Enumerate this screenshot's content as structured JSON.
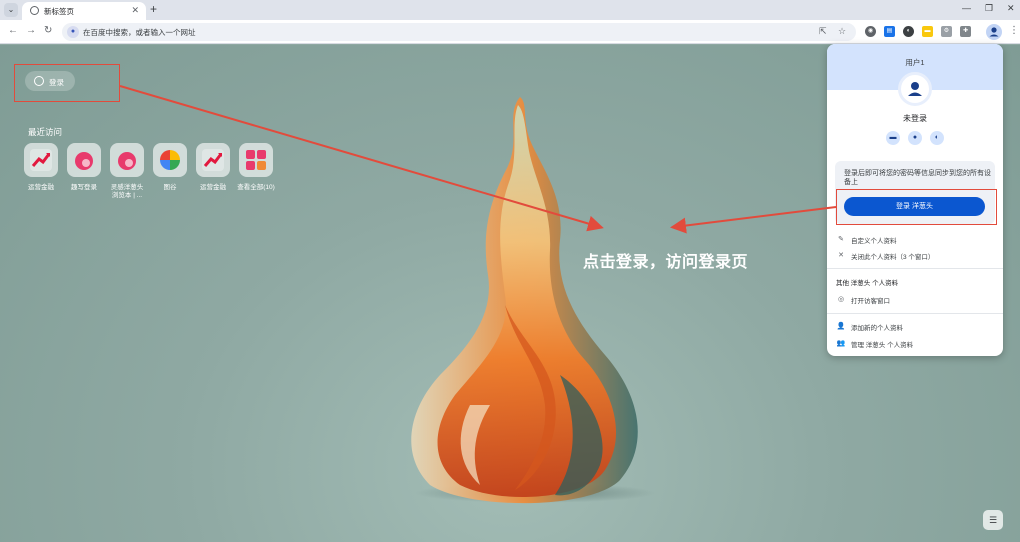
{
  "tab": {
    "title": "新标签页"
  },
  "omnibox": {
    "placeholder": "在百度中搜索，或者输入一个网址"
  },
  "ntp": {
    "signin_label": "登录",
    "recent_title": "最近访问",
    "shortcuts": [
      {
        "label": "运营金融",
        "icon": "chart-up-icon"
      },
      {
        "label": "趣写登录",
        "icon": "flame-logo-icon"
      },
      {
        "label": "灵感洋葱头\n浏览本 | ...",
        "icon": "flame-logo-icon"
      },
      {
        "label": "图谷",
        "icon": "colorful-pie-icon"
      },
      {
        "label": "运营金融",
        "icon": "chart-up-icon"
      },
      {
        "label": "查看全部(10)",
        "icon": "grid-apps-icon"
      }
    ],
    "annotation": "点击登录，访问登录页"
  },
  "profile_menu": {
    "user_label": "用户1",
    "status": "未登录",
    "promo_text": "登录后即可将您的密码等信息同步到您的所有设备上",
    "signin_button": "登录 洋葱头",
    "items": [
      {
        "label": "自定义个人资料",
        "icon": "pencil-icon"
      },
      {
        "label": "关闭此个人资料（3 个窗口）",
        "icon": "close-icon"
      }
    ],
    "section_title": "其他 洋葱头 个人资料",
    "guest_label": "打开访客窗口",
    "bottom_items": [
      {
        "label": "添加新的个人资料",
        "icon": "add-person-icon"
      },
      {
        "label": "管理 洋葱头 个人资料",
        "icon": "manage-people-icon"
      }
    ]
  },
  "colors": {
    "accent_blue": "#0b57d0",
    "header_blue": "#d3e3fd",
    "annotation_red": "#e24b3c"
  }
}
